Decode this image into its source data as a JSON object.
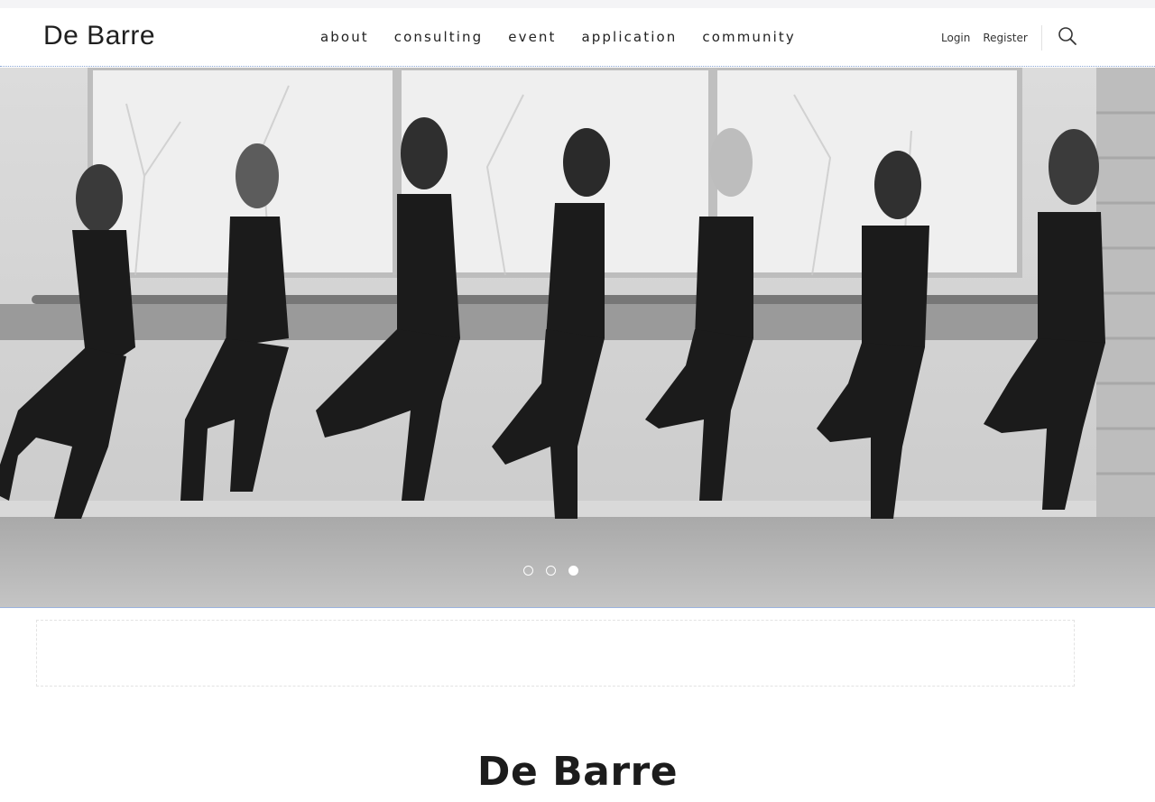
{
  "header": {
    "logo": "De Barre",
    "nav": [
      "about",
      "consulting",
      "event",
      "application",
      "community"
    ],
    "login": "Login",
    "register": "Register",
    "search_icon": "search-icon"
  },
  "hero": {
    "slides_count": 3,
    "active_slide": 3,
    "image_description": ""
  },
  "section": {
    "title": "De Barre"
  },
  "colors": {
    "text": "#222222",
    "accent_border": "#9bb3df"
  }
}
